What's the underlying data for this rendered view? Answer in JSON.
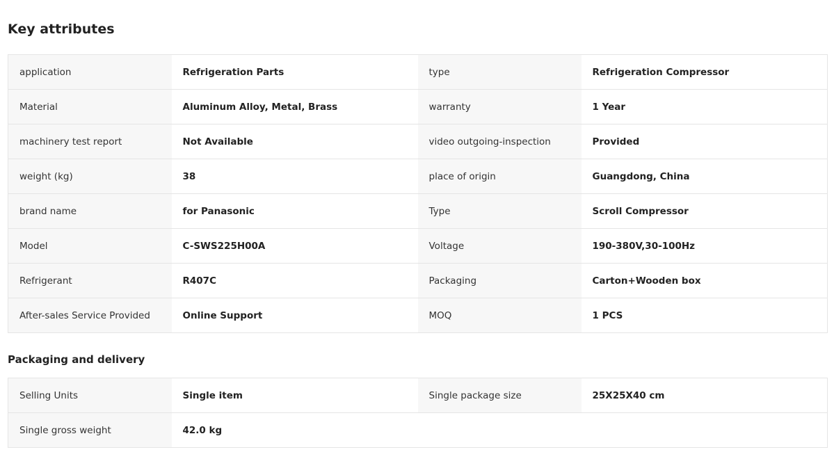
{
  "key_attributes": {
    "title": "Key attributes",
    "rows": [
      {
        "k1": "application",
        "v1": "Refrigeration Parts",
        "k2": "type",
        "v2": "Refrigeration Compressor"
      },
      {
        "k1": "Material",
        "v1": "Aluminum Alloy, Metal, Brass",
        "k2": "warranty",
        "v2": "1 Year"
      },
      {
        "k1": "machinery test report",
        "v1": "Not Available",
        "k2": "video outgoing-inspection",
        "v2": "Provided"
      },
      {
        "k1": "weight (kg)",
        "v1": "38",
        "k2": "place of origin",
        "v2": "Guangdong, China"
      },
      {
        "k1": "brand name",
        "v1": "for Panasonic",
        "k2": "Type",
        "v2": "Scroll Compressor"
      },
      {
        "k1": "Model",
        "v1": "C-SWS225H00A",
        "k2": "Voltage",
        "v2": "190-380V,30-100Hz"
      },
      {
        "k1": "Refrigerant",
        "v1": "R407C",
        "k2": "Packaging",
        "v2": "Carton+Wooden box"
      },
      {
        "k1": "After-sales Service Provided",
        "v1": "Online Support",
        "k2": "MOQ",
        "v2": "1 PCS"
      }
    ]
  },
  "packaging": {
    "title": "Packaging and delivery",
    "rows": [
      {
        "k1": "Selling Units",
        "v1": "Single item",
        "k2": "Single package size",
        "v2": "25X25X40 cm"
      },
      {
        "k1": "Single gross weight",
        "v1": "42.0 kg"
      }
    ]
  }
}
